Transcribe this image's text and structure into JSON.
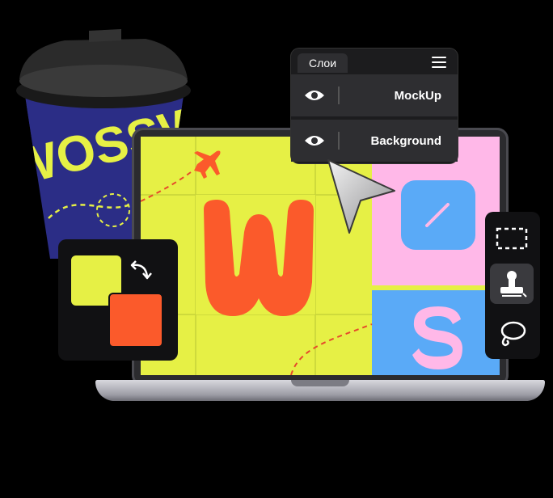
{
  "layers_panel": {
    "tab_label": "Слои",
    "menu_icon": "hamburger-menu-icon",
    "layers": [
      {
        "name": "MockUp",
        "visibility_icon": "eye-icon"
      },
      {
        "name": "Background",
        "visibility_icon": "eye-icon"
      }
    ]
  },
  "tools_panel": {
    "tools": [
      "rectangle-marquee-icon",
      "stamp-icon",
      "lasso-icon"
    ],
    "active_tool": "stamp-icon"
  },
  "color_panel": {
    "foreground_color": "#e6f045",
    "background_color": "#fb5a2b",
    "swap_icon": "swap-colors-icon"
  },
  "canvas": {
    "logo_letter_primary": "W",
    "logo_letter_secondary": "S",
    "colors": {
      "lime": "#e6f045",
      "orange": "#fb5a2b",
      "pink": "#ffb8e8",
      "blue": "#5aaaf7",
      "navy": "#2b2d86"
    }
  },
  "cup": {
    "print_text": "WOSSWO"
  }
}
